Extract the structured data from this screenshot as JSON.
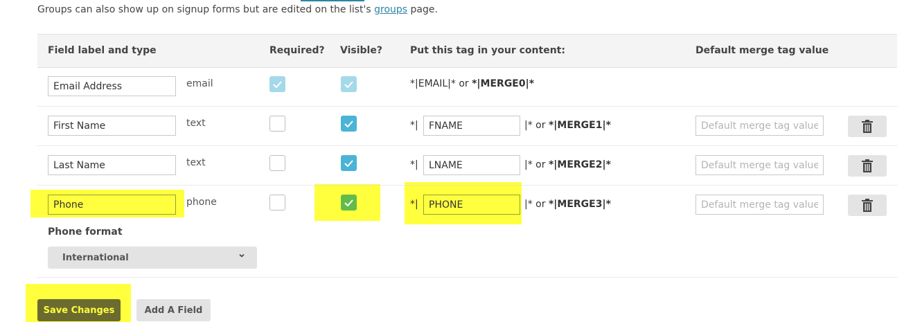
{
  "intro": {
    "prefix": "Groups can also show up on signup forms but are edited on the list's ",
    "link": "groups",
    "suffix": " page."
  },
  "table": {
    "headers": {
      "field": "Field label and type",
      "required": "Required?",
      "visible": "Visible?",
      "tag": "Put this tag in your content:",
      "default": "Default merge tag value"
    },
    "rows": [
      {
        "label": "Email Address",
        "type": "email",
        "required": true,
        "visible": true,
        "locked": true,
        "merge_static": "*|EMAIL|*",
        "or": "or",
        "merge_tag": "*|MERGE0|*"
      },
      {
        "label": "First Name",
        "type": "text",
        "required": false,
        "visible": true,
        "tag_prefix": "*|",
        "tag_value": "FNAME",
        "tag_suffix": "|*",
        "or": "or",
        "merge_tag": "*|MERGE1|*",
        "default_placeholder": "Default merge tag value"
      },
      {
        "label": "Last Name",
        "type": "text",
        "required": false,
        "visible": true,
        "tag_prefix": "*|",
        "tag_value": "LNAME",
        "tag_suffix": "|*",
        "or": "or",
        "merge_tag": "*|MERGE2|*",
        "default_placeholder": "Default merge tag value"
      },
      {
        "label": "Phone",
        "type": "phone",
        "required": false,
        "visible": true,
        "tag_prefix": "*|",
        "tag_value": "PHONE",
        "tag_suffix": "|*",
        "or": "or",
        "merge_tag": "*|MERGE3|*",
        "default_placeholder": "Default merge tag value"
      }
    ]
  },
  "phone_format": {
    "label": "Phone format",
    "selected": "International"
  },
  "buttons": {
    "save": "Save Changes",
    "add": "Add A Field"
  },
  "colors": {
    "highlight": "#ffff3d",
    "checkbox_blue": "#4ab4d6",
    "checkbox_green": "#63bb4c",
    "link": "#2a84a8",
    "save_bg": "#6b6b30"
  },
  "icons": {
    "trash": "trash-icon",
    "check": "check-icon",
    "chevron": "chevron-down-icon"
  }
}
